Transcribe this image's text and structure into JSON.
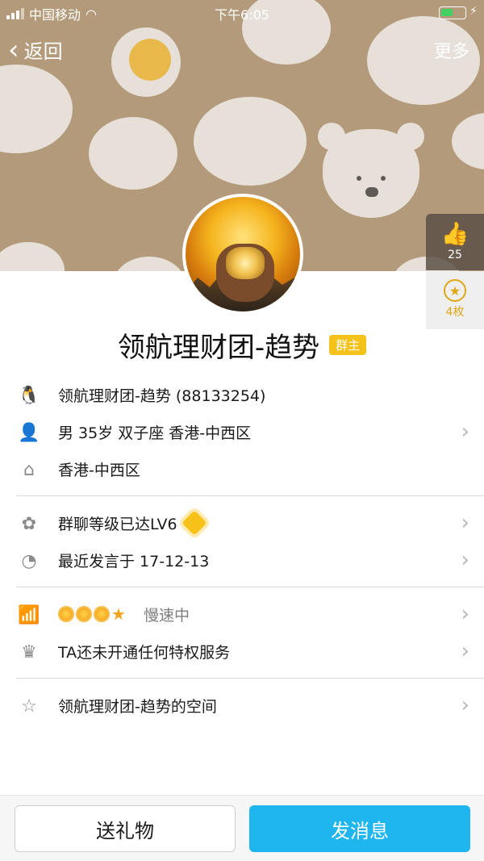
{
  "status_bar": {
    "carrier": "中国移动",
    "time": "下午6:05"
  },
  "nav": {
    "back_label": "返回",
    "more_label": "更多"
  },
  "side": {
    "like_count": "25",
    "badge_count": "4枚"
  },
  "profile": {
    "name": "领航理财团-趋势",
    "role_badge": "群主"
  },
  "rows": {
    "qq": "领航理财团-趋势 (88133254)",
    "info": "男 35岁 双子座 香港-中西区",
    "home": "香港-中西区",
    "group_level": "群聊等级已达LV6",
    "last_speak": "最近发言于 17-12-13",
    "speed": "慢速中",
    "privilege": "TA还未开通任何特权服务",
    "space": "领航理财团-趋势的空间"
  },
  "footer": {
    "gift_label": "送礼物",
    "message_label": "发消息"
  },
  "colors": {
    "banner": "#b39a7a",
    "accent_blue": "#1fb6ef",
    "badge_yellow": "#f4c21a"
  },
  "icons": {
    "qq": "qq-penguin-icon",
    "person": "person-icon",
    "home": "home-icon",
    "level": "gear-flower-icon",
    "clock": "clock-icon",
    "chart": "rank-chart-icon",
    "crown": "crown-icon",
    "space": "star-space-icon"
  }
}
